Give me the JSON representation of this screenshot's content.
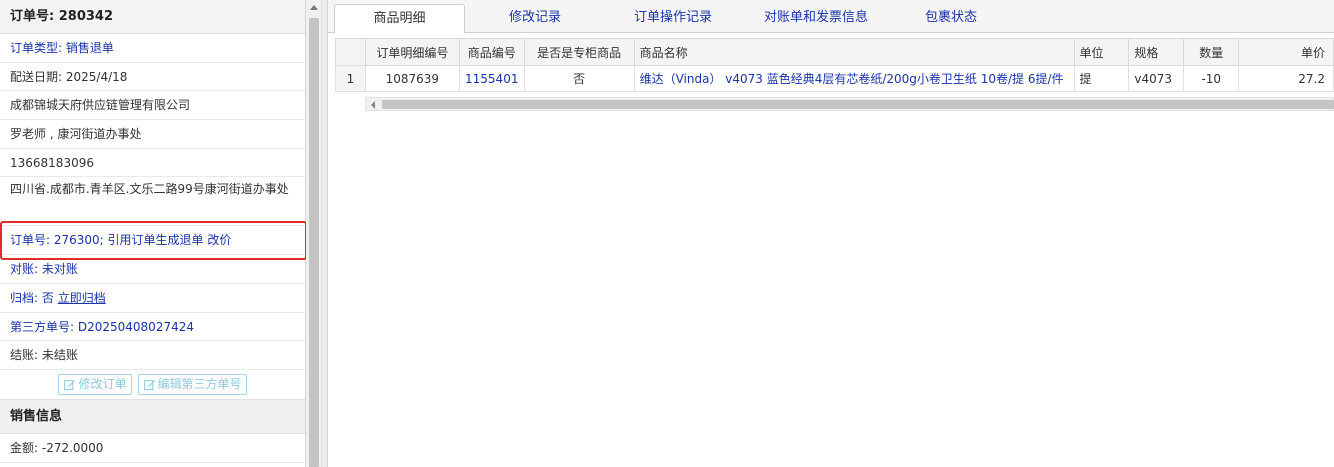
{
  "left": {
    "title": "订单号: 280342",
    "order_type": "订单类型: 销售退单",
    "delivery_date": "配送日期: 2025/4/18",
    "company": "成都锦城天府供应链管理有限公司",
    "contact": "罗老师 , 康河街道办事处",
    "phone": "13668183096",
    "address": "四川省.成都市.青羊区.文乐二路99号康河街道办事处",
    "ref_order_prefix": "订单号: 276300; ",
    "ref_order_action": "引用订单生成退单",
    "ref_order_change": "改价",
    "reconcile": "对账: 未对账",
    "archive_label": "归档:  否 ",
    "archive_action": "立即归档",
    "third_party_label": "第三方单号: ",
    "third_party_value": "D20250408027424",
    "settle": "结账: 未结账",
    "edit_order_button": "修改订单",
    "edit_third_party_button": "编辑第三方单号",
    "sales_section": "销售信息",
    "amount": "金额: -272.0000"
  },
  "tabs": [
    {
      "label": "商品明细"
    },
    {
      "label": "修改记录"
    },
    {
      "label": "订单操作记录"
    },
    {
      "label": "对账单和发票信息"
    },
    {
      "label": "包裹状态"
    }
  ],
  "table": {
    "headers": [
      "",
      "订单明细编号",
      "商品编号",
      "是否是专柜商品",
      "商品名称",
      "单位",
      "规格",
      "数量",
      "单价"
    ],
    "rows": [
      [
        "1",
        "1087639",
        "1155401",
        "否",
        "维达（Vinda） v4073 蓝色经典4层有芯卷纸/200g小卷卫生纸 10卷/提 6提/件",
        "提",
        "v4073",
        "-10",
        "27.2"
      ]
    ]
  },
  "colors": {
    "link": "#1a34a8",
    "highlight_border": "#e32b2b",
    "button_border": "#a8d4e6"
  }
}
